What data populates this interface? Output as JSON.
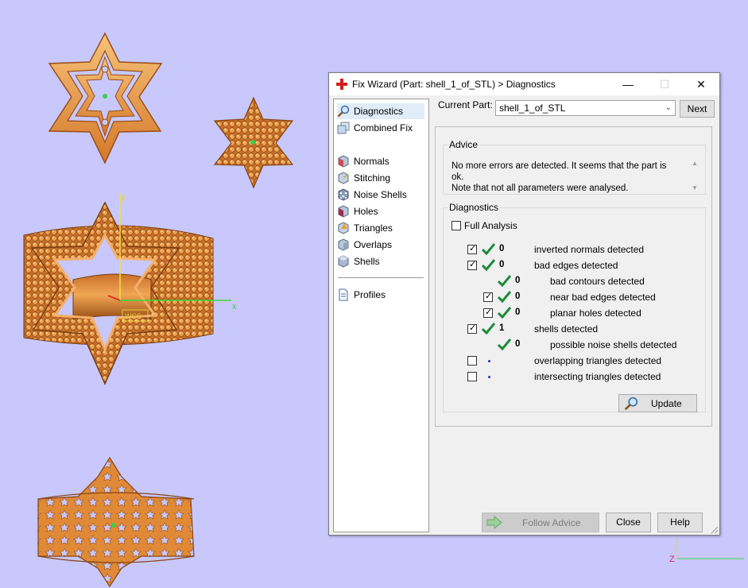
{
  "window": {
    "title": "Fix Wizard (Part: shell_1_of_STL) > Diagnostics",
    "controls": {
      "minimize": "—",
      "maximize": "☐",
      "close": "✕"
    }
  },
  "nav": {
    "items": [
      {
        "label": "Diagnostics",
        "icon": "magnifier-icon",
        "selected": true
      },
      {
        "label": "Combined Fix",
        "icon": "combined-fix-icon"
      },
      {
        "label": "Normals",
        "icon": "normals-cube-icon"
      },
      {
        "label": "Stitching",
        "icon": "stitching-cube-icon"
      },
      {
        "label": "Noise Shells",
        "icon": "noise-shells-icon"
      },
      {
        "label": "Holes",
        "icon": "holes-cube-icon"
      },
      {
        "label": "Triangles",
        "icon": "triangles-cube-icon"
      },
      {
        "label": "Overlaps",
        "icon": "overlaps-cube-icon"
      },
      {
        "label": "Shells",
        "icon": "shells-cube-icon"
      }
    ],
    "profiles_label": "Profiles"
  },
  "current_part": {
    "label": "Current Part:",
    "value": "shell_1_of_STL"
  },
  "next_label": "Next",
  "advice": {
    "title": "Advice",
    "line1": "No more errors are detected. It seems that the part is ok.",
    "line2": "Note that not all parameters were analysed."
  },
  "diagnostics": {
    "title": "Diagnostics",
    "full_analysis_label": "Full Analysis",
    "rows": [
      {
        "label": "inverted normals detected",
        "value": "0",
        "checkbox": true,
        "checked": true
      },
      {
        "label": "bad edges detected",
        "value": "0",
        "checkbox": true,
        "checked": true
      },
      {
        "label": "bad contours detected",
        "value": "0",
        "checkbox": false
      },
      {
        "label": "near bad edges detected",
        "value": "0",
        "checkbox": true,
        "checked": true
      },
      {
        "label": "planar holes detected",
        "value": "0",
        "checkbox": true,
        "checked": true
      },
      {
        "label": "shells detected",
        "value": "1",
        "checkbox": true,
        "checked": true
      },
      {
        "label": "possible noise shells detected",
        "value": "0",
        "checkbox": false
      },
      {
        "label": "overlapping triangles detected",
        "value": "",
        "checkbox": true,
        "checked": false
      },
      {
        "label": "intersecting triangles detected",
        "value": "",
        "checkbox": true,
        "checked": false
      }
    ]
  },
  "buttons": {
    "update": "Update",
    "follow_advice": "Follow Advice",
    "close": "Close",
    "help": "Help"
  },
  "viewport": {
    "axis_x": "x",
    "axis_y": "y",
    "wcs_label": "WCS",
    "corner_axis": "Z",
    "colors": {
      "background": "#c8c8fc",
      "part": "#e8953c",
      "part_dark": "#a0561a"
    }
  }
}
